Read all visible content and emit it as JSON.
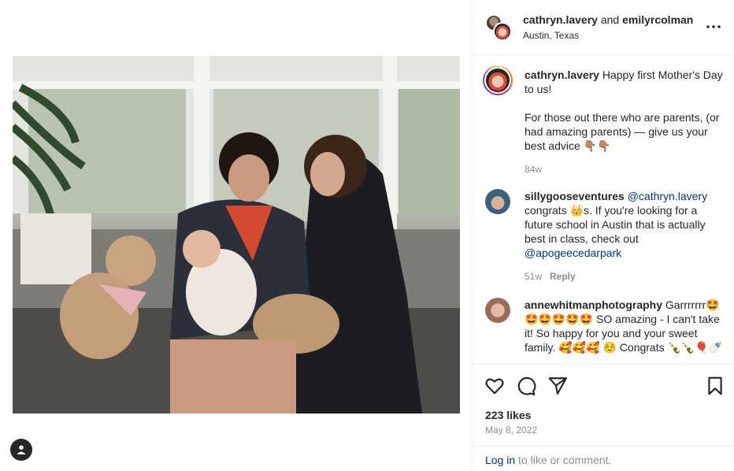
{
  "post": {
    "owners": [
      "cathryn.lavery",
      "emilyrcolman"
    ],
    "owners_joiner": "and",
    "location": "Austin, Texas"
  },
  "caption": {
    "username": "cathryn.lavery",
    "line1": "Happy first Mother's Day to us!",
    "line2": "For those out there who are parents, (or had amazing parents) — give us your best advice 👇🏽👇🏽",
    "time": "84w"
  },
  "comments": [
    {
      "username": "sillygooseventures",
      "mention": "@cathryn.lavery",
      "text_a": "congrats 👑s. If you're looking for a future school in Austin that is actually best in class, check out",
      "mention2": "@apogeecedarpark",
      "time": "51w",
      "reply_label": "Reply"
    },
    {
      "username": "annewhitmanphotography",
      "text": "Garrrrrrr🤩🤩🤩🤩🤩🤩 SO amazing - I can't take it! So happy for you and your sweet family. 🥰🥰🥰 ☺️ Congrats 🍾🍾🎈🍼"
    }
  ],
  "likes": "223 likes",
  "date": "May 8, 2022",
  "footer": {
    "login_label": "Log in",
    "rest": " to like or comment."
  },
  "icons": {
    "more": "more-options-icon",
    "like": "heart-icon",
    "comment": "comment-icon",
    "share": "share-icon",
    "save": "bookmark-icon",
    "profile": "user-icon"
  }
}
